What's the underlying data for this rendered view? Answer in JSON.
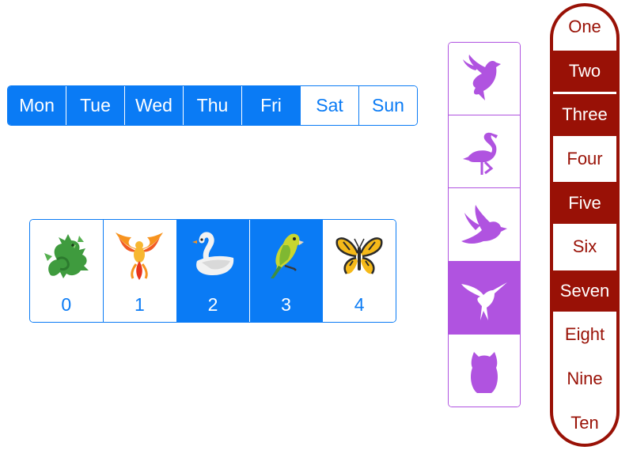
{
  "days": {
    "items": [
      {
        "label": "Mon",
        "selected": true
      },
      {
        "label": "Tue",
        "selected": true
      },
      {
        "label": "Wed",
        "selected": true
      },
      {
        "label": "Thu",
        "selected": true
      },
      {
        "label": "Fri",
        "selected": true
      },
      {
        "label": "Sat",
        "selected": false
      },
      {
        "label": "Sun",
        "selected": false
      }
    ]
  },
  "creatures": {
    "items": [
      {
        "label": "0",
        "icon": "dragon-icon",
        "selected": false
      },
      {
        "label": "1",
        "icon": "phoenix-icon",
        "selected": false
      },
      {
        "label": "2",
        "icon": "swan-icon",
        "selected": true
      },
      {
        "label": "3",
        "icon": "parrot-icon",
        "selected": true
      },
      {
        "label": "4",
        "icon": "butterfly-icon",
        "selected": false
      }
    ]
  },
  "birds": {
    "items": [
      {
        "icon": "dove-icon",
        "selected": false
      },
      {
        "icon": "flamingo-icon",
        "selected": false
      },
      {
        "icon": "duck-icon",
        "selected": false
      },
      {
        "icon": "hummingbird-icon",
        "selected": true
      },
      {
        "icon": "owl-icon",
        "selected": false
      }
    ]
  },
  "numbers": {
    "items": [
      {
        "label": "One",
        "selected": false
      },
      {
        "label": "Two",
        "selected": true
      },
      {
        "label": "Three",
        "selected": true
      },
      {
        "label": "Four",
        "selected": false
      },
      {
        "label": "Five",
        "selected": true
      },
      {
        "label": "Six",
        "selected": false
      },
      {
        "label": "Seven",
        "selected": true
      },
      {
        "label": "Eight",
        "selected": false
      },
      {
        "label": "Nine",
        "selected": false
      },
      {
        "label": "Ten",
        "selected": false
      }
    ]
  },
  "colors": {
    "blue_accent": "#0a7bf5",
    "purple_accent": "#b053e0",
    "red_accent": "#991106"
  }
}
